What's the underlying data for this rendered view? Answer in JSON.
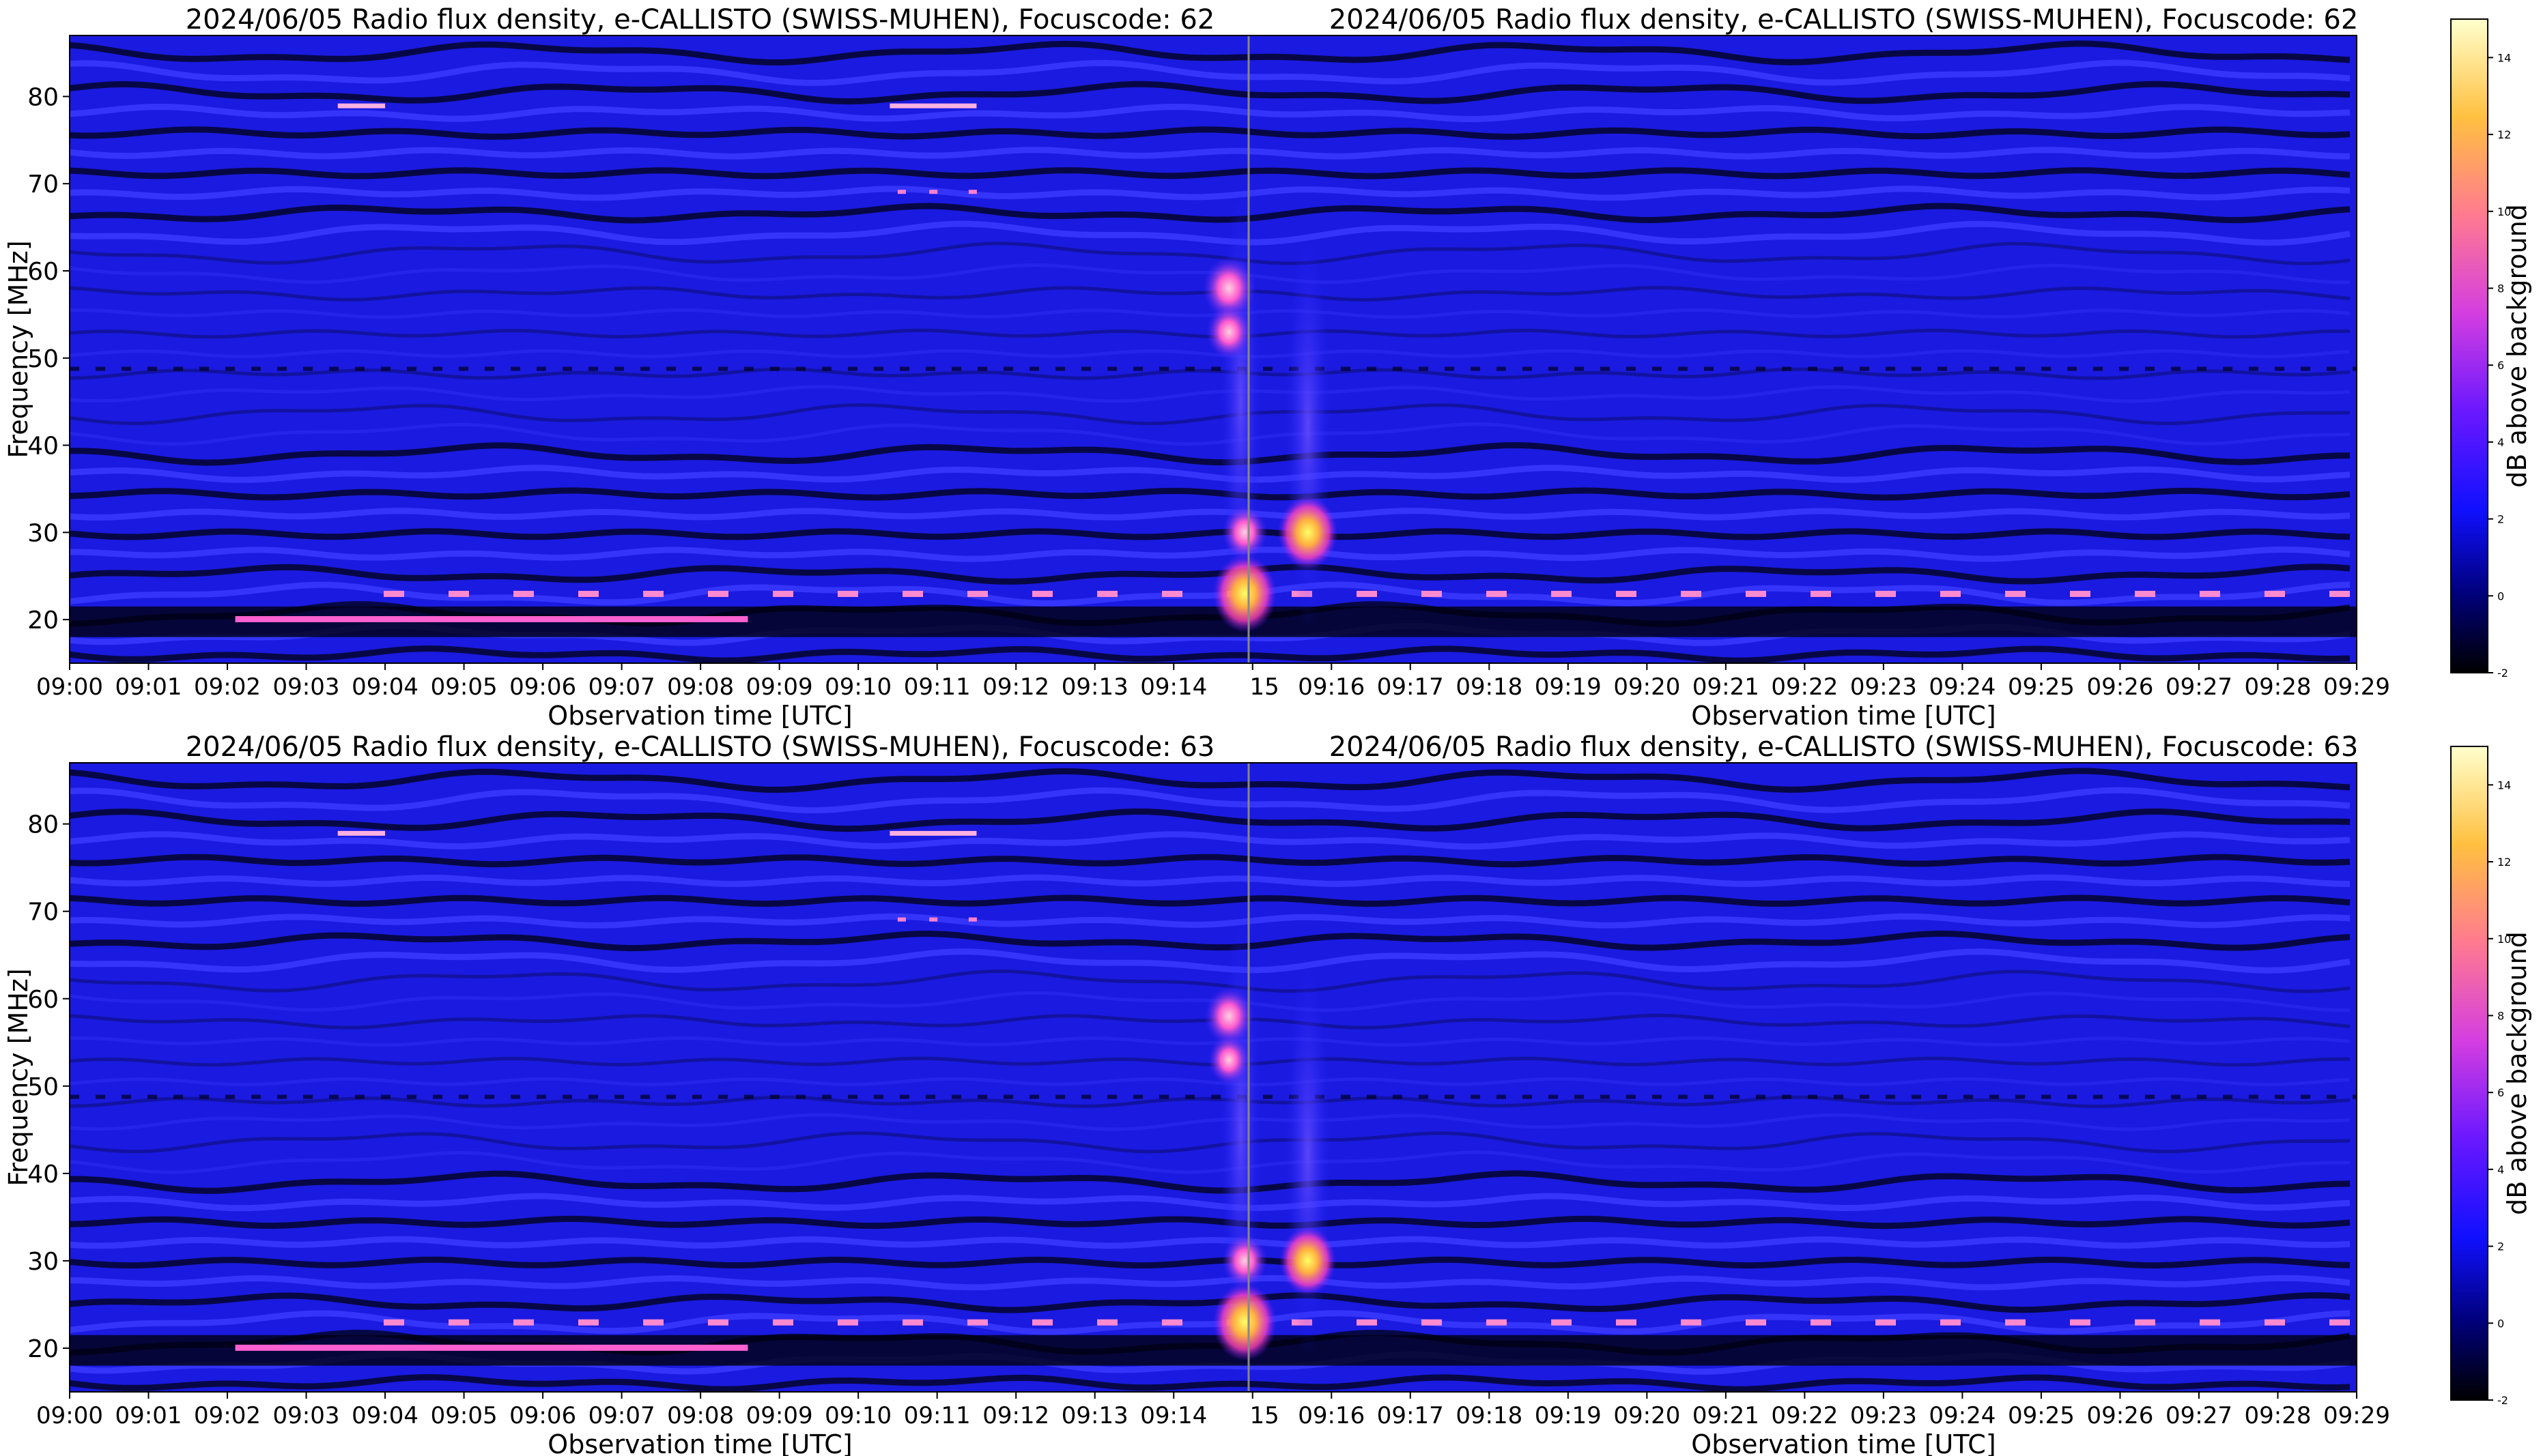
{
  "chart_data": [
    {
      "type": "heatmap",
      "title_left": "2024/06/05  Radio flux density, e-CALLISTO (SWISS-MUHEN), Focuscode: 62",
      "title_right": "2024/06/05  Radio flux density, e-CALLISTO (SWISS-MUHEN), Focuscode: 62",
      "xlabel": "Observation time [UTC]",
      "ylabel": "Frequency [MHz]",
      "x_ticks_left": [
        "09:00",
        "09:01",
        "09:02",
        "09:03",
        "09:04",
        "09:05",
        "09:06",
        "09:07",
        "09:08",
        "09:09",
        "09:10",
        "09:11",
        "09:12",
        "09:13",
        "09:14"
      ],
      "x_ticks_right": [
        "15",
        "09:16",
        "09:17",
        "09:18",
        "09:19",
        "09:20",
        "09:21",
        "09:22",
        "09:23",
        "09:24",
        "09:25",
        "09:26",
        "09:27",
        "09:28",
        "09:29"
      ],
      "y_ticks": [
        20,
        30,
        40,
        50,
        60,
        70,
        80
      ],
      "ylim": [
        15,
        87
      ],
      "xlim_minutes": [
        0,
        29
      ],
      "colorbar_label": "dB above background",
      "colorbar_ticks": [
        -2,
        0,
        2,
        4,
        6,
        8,
        10,
        12,
        14
      ],
      "colorbar_range": [
        -2,
        15
      ],
      "bright_features": [
        {
          "time_min": 14.9,
          "freq_mhz": 23,
          "db": 14
        },
        {
          "time_min": 14.9,
          "freq_mhz": 30,
          "db": 9
        },
        {
          "time_min": 14.7,
          "freq_mhz": 58,
          "db": 11
        },
        {
          "time_min": 14.7,
          "freq_mhz": 53,
          "db": 9
        },
        {
          "time_min": 15.7,
          "freq_mhz": 30,
          "db": 13
        }
      ]
    },
    {
      "type": "heatmap",
      "title_left": "2024/06/05  Radio flux density, e-CALLISTO (SWISS-MUHEN), Focuscode: 63",
      "title_right": "2024/06/05  Radio flux density, e-CALLISTO (SWISS-MUHEN), Focuscode: 63",
      "xlabel": "Observation time [UTC]",
      "ylabel": "Frequency [MHz]",
      "x_ticks_left": [
        "09:00",
        "09:01",
        "09:02",
        "09:03",
        "09:04",
        "09:05",
        "09:06",
        "09:07",
        "09:08",
        "09:09",
        "09:10",
        "09:11",
        "09:12",
        "09:13",
        "09:14"
      ],
      "x_ticks_right": [
        "15",
        "09:16",
        "09:17",
        "09:18",
        "09:19",
        "09:20",
        "09:21",
        "09:22",
        "09:23",
        "09:24",
        "09:25",
        "09:26",
        "09:27",
        "09:28",
        "09:29"
      ],
      "y_ticks": [
        20,
        30,
        40,
        50,
        60,
        70,
        80
      ],
      "ylim": [
        15,
        87
      ],
      "xlim_minutes": [
        0,
        29
      ],
      "colorbar_label": "dB above background",
      "colorbar_ticks": [
        -2,
        0,
        2,
        4,
        6,
        8,
        10,
        12,
        14
      ],
      "colorbar_range": [
        -2,
        15
      ],
      "bright_features": [
        {
          "time_min": 14.9,
          "freq_mhz": 23,
          "db": 14
        },
        {
          "time_min": 14.9,
          "freq_mhz": 30,
          "db": 9
        },
        {
          "time_min": 14.7,
          "freq_mhz": 58,
          "db": 10
        },
        {
          "time_min": 14.7,
          "freq_mhz": 53,
          "db": 8
        },
        {
          "time_min": 15.7,
          "freq_mhz": 30,
          "db": 12
        }
      ]
    }
  ],
  "colors": {
    "background": "#1a1ae0",
    "band_dark": "#05052a",
    "band_bright": "#3a3aff",
    "hot": "#ff7ad0",
    "peak": "#ffe24a"
  }
}
